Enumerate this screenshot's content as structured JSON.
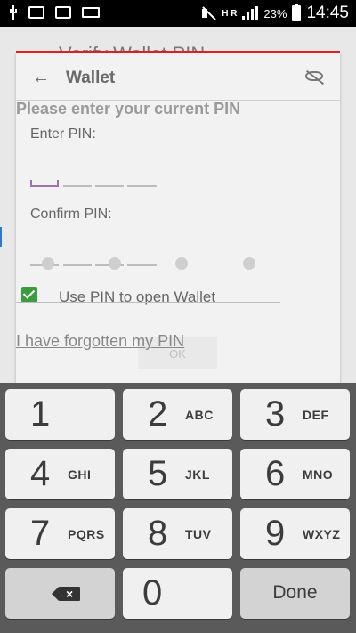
{
  "status_bar": {
    "network_label": "H R",
    "battery_percent": "23%",
    "time": "14:45"
  },
  "background_page": {
    "title": "Verify Wallet PIN"
  },
  "dialog": {
    "title": "Wallet",
    "instruction": "Please enter your current PIN",
    "enter_pin_label": "Enter PIN:",
    "confirm_pin_label": "Confirm PIN:",
    "checkbox_label": "Use PIN to open Wallet",
    "checkbox_checked": true,
    "forgot_link": "I have forgotten my PIN",
    "ok_button": "OK"
  },
  "keypad": {
    "keys": [
      {
        "num": "1",
        "letters": ""
      },
      {
        "num": "2",
        "letters": "ABC"
      },
      {
        "num": "3",
        "letters": "DEF"
      },
      {
        "num": "4",
        "letters": "GHI"
      },
      {
        "num": "5",
        "letters": "JKL"
      },
      {
        "num": "6",
        "letters": "MNO"
      },
      {
        "num": "7",
        "letters": "PQRS"
      },
      {
        "num": "8",
        "letters": "TUV"
      },
      {
        "num": "9",
        "letters": "WXYZ"
      },
      {
        "num": "0",
        "letters": ""
      }
    ],
    "done_label": "Done"
  },
  "colors": {
    "accent_red": "#e02020",
    "checkbox_green": "#3b9b3f",
    "focus_purple": "#a070b0"
  }
}
